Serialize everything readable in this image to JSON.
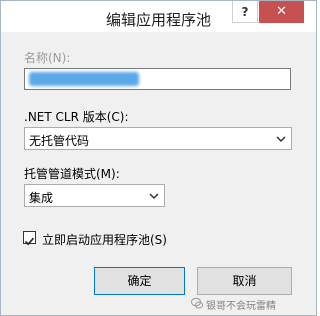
{
  "dialog": {
    "title": "编辑应用程序池",
    "help_label": "?",
    "close_label": "✕"
  },
  "name_field": {
    "label": "名称(N):",
    "value": ""
  },
  "clr_version": {
    "label": ".NET CLR 版本(C):",
    "selected": "无托管代码"
  },
  "pipeline_mode": {
    "label": "托管管道模式(M):",
    "selected": "集成"
  },
  "autostart": {
    "label": "立即启动应用程序池(S)",
    "checked": true
  },
  "buttons": {
    "ok": "确定",
    "cancel": "取消"
  },
  "watermark": {
    "text": "银哥不会玩雷精"
  }
}
